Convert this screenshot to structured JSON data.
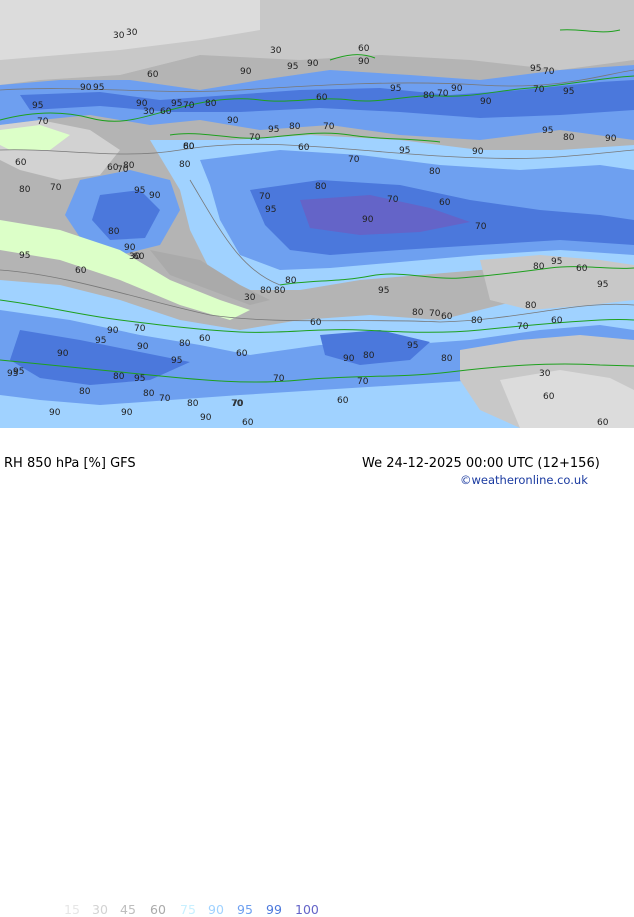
{
  "header": {
    "title": "RH 850 hPa [%] GFS",
    "datetime": "We 24-12-2025 00:00 UTC (12+156)",
    "credit": "©weatheronline.co.uk"
  },
  "legend": {
    "values": [
      "15",
      "30",
      "45",
      "60",
      "75",
      "90",
      "95",
      "99",
      "100"
    ],
    "colors": [
      "#e6e6e6",
      "#d2d2d2",
      "#bebebe",
      "#aaaaaa",
      "#c8f0ff",
      "#a0d2ff",
      "#6ea0f0",
      "#4b78dc",
      "#6464c8"
    ]
  },
  "map": {
    "contour_labels": [
      {
        "t": "30"
      },
      {
        "t": "30"
      },
      {
        "t": "60"
      },
      {
        "t": "30"
      },
      {
        "t": "60"
      },
      {
        "t": "90"
      },
      {
        "t": "90"
      },
      {
        "t": "90"
      },
      {
        "t": "95"
      },
      {
        "t": "90"
      },
      {
        "t": "95"
      },
      {
        "t": "70"
      },
      {
        "t": "95"
      },
      {
        "t": "70"
      },
      {
        "t": "95"
      },
      {
        "t": "90"
      },
      {
        "t": "95"
      },
      {
        "t": "70"
      },
      {
        "t": "80"
      },
      {
        "t": "30"
      },
      {
        "t": "60"
      },
      {
        "t": "90"
      },
      {
        "t": "95"
      },
      {
        "t": "70"
      },
      {
        "t": "80"
      },
      {
        "t": "95"
      },
      {
        "t": "70"
      },
      {
        "t": "60"
      },
      {
        "t": "90"
      },
      {
        "t": "70"
      },
      {
        "t": "90"
      },
      {
        "t": "95"
      },
      {
        "t": "60"
      },
      {
        "t": "80"
      },
      {
        "t": "80"
      },
      {
        "t": "60"
      },
      {
        "t": "70"
      },
      {
        "t": "95"
      },
      {
        "t": "80"
      },
      {
        "t": "90"
      },
      {
        "t": "60"
      },
      {
        "t": "80"
      },
      {
        "t": "70"
      },
      {
        "t": "95"
      },
      {
        "t": "80"
      },
      {
        "t": "60"
      },
      {
        "t": "90"
      },
      {
        "t": "80"
      },
      {
        "t": "90"
      },
      {
        "t": "60"
      },
      {
        "t": "80"
      },
      {
        "t": "70"
      },
      {
        "t": "70"
      },
      {
        "t": "95"
      },
      {
        "t": "80"
      },
      {
        "t": "90"
      },
      {
        "t": "95"
      },
      {
        "t": "80"
      },
      {
        "t": "70"
      },
      {
        "t": "60"
      },
      {
        "t": "70"
      },
      {
        "t": "80"
      },
      {
        "t": "60"
      },
      {
        "t": "95"
      },
      {
        "t": "80"
      },
      {
        "t": "90"
      },
      {
        "t": "95"
      },
      {
        "t": "30"
      },
      {
        "t": "60"
      },
      {
        "t": "30"
      },
      {
        "t": "80"
      },
      {
        "t": "70"
      },
      {
        "t": "95"
      },
      {
        "t": "80"
      },
      {
        "t": "95"
      },
      {
        "t": "60"
      },
      {
        "t": "80"
      },
      {
        "t": "95"
      },
      {
        "t": "80"
      },
      {
        "t": "70"
      },
      {
        "t": "60"
      },
      {
        "t": "80"
      },
      {
        "t": "60"
      },
      {
        "t": "70"
      },
      {
        "t": "60"
      },
      {
        "t": "90"
      },
      {
        "t": "70"
      },
      {
        "t": "95"
      },
      {
        "t": "90"
      },
      {
        "t": "80"
      },
      {
        "t": "60"
      },
      {
        "t": "95"
      },
      {
        "t": "90"
      },
      {
        "t": "80"
      },
      {
        "t": "95"
      },
      {
        "t": "95"
      },
      {
        "t": "90"
      },
      {
        "t": "80"
      },
      {
        "t": "70"
      },
      {
        "t": "80"
      },
      {
        "t": "95"
      },
      {
        "t": "80"
      },
      {
        "t": "70"
      },
      {
        "t": "80"
      },
      {
        "t": "90"
      },
      {
        "t": "90"
      },
      {
        "t": "70"
      },
      {
        "t": "70"
      },
      {
        "t": "90"
      },
      {
        "t": "60"
      },
      {
        "t": "60"
      },
      {
        "t": "30"
      },
      {
        "t": "60"
      },
      {
        "t": "60"
      },
      {
        "t": "70"
      },
      {
        "t": "80"
      }
    ]
  }
}
